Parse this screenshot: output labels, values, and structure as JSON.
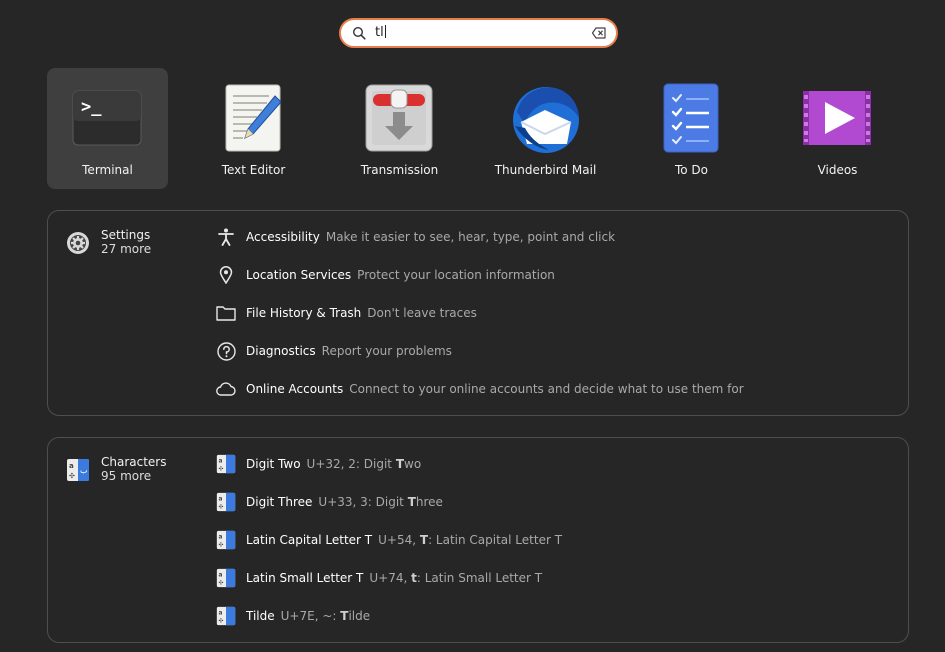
{
  "search": {
    "query": "tl"
  },
  "apps": [
    {
      "label": "Terminal",
      "icon": "terminal-icon",
      "selected": true
    },
    {
      "label": "Text Editor",
      "icon": "text-editor-icon"
    },
    {
      "label": "Transmission",
      "icon": "transmission-icon"
    },
    {
      "label": "Thunderbird Mail",
      "icon": "thunderbird-icon"
    },
    {
      "label": "To Do",
      "icon": "todo-icon"
    },
    {
      "label": "Videos",
      "icon": "videos-icon"
    }
  ],
  "settings": {
    "provider": "Settings",
    "more": "27 more",
    "results": [
      {
        "title": "Accessibility",
        "desc": "Make it easier to see, hear, type, point and click",
        "icon": "accessibility-icon"
      },
      {
        "title": "Location Services",
        "desc": "Protect your location information",
        "icon": "location-pin-icon"
      },
      {
        "title": "File History & Trash",
        "desc": "Don't leave traces",
        "icon": "folder-icon"
      },
      {
        "title": "Diagnostics",
        "desc": "Report your problems",
        "icon": "help-circle-icon"
      },
      {
        "title": "Online Accounts",
        "desc": "Connect to your online accounts and decide what to use them for",
        "icon": "cloud-icon"
      }
    ]
  },
  "characters": {
    "provider": "Characters",
    "more": "95 more",
    "results": [
      {
        "title": "Digit Two",
        "desc_prefix": "U+32, 2: Digit ",
        "desc_bold": "T",
        "desc_suffix": "wo",
        "icon": "characters-icon"
      },
      {
        "title": "Digit Three",
        "desc_prefix": "U+33, 3: Digit ",
        "desc_bold": "T",
        "desc_suffix": "hree",
        "icon": "characters-icon"
      },
      {
        "title": "Latin Capital Letter T",
        "desc_prefix": "U+54, ",
        "desc_bold": "T",
        "desc_suffix": ": Latin Capital Letter T",
        "icon": "characters-icon"
      },
      {
        "title": "Latin Small Letter T",
        "desc_prefix": "U+74, ",
        "desc_bold": "t",
        "desc_suffix": ": Latin Small Letter T",
        "icon": "characters-icon"
      },
      {
        "title": "Tilde",
        "desc_prefix": "U+7E, ~: ",
        "desc_bold": "T",
        "desc_suffix": "ilde",
        "icon": "characters-icon"
      }
    ]
  },
  "colors": {
    "accent": "#e97e4a",
    "background": "#262626",
    "panel_border": "#4e4e4e"
  }
}
